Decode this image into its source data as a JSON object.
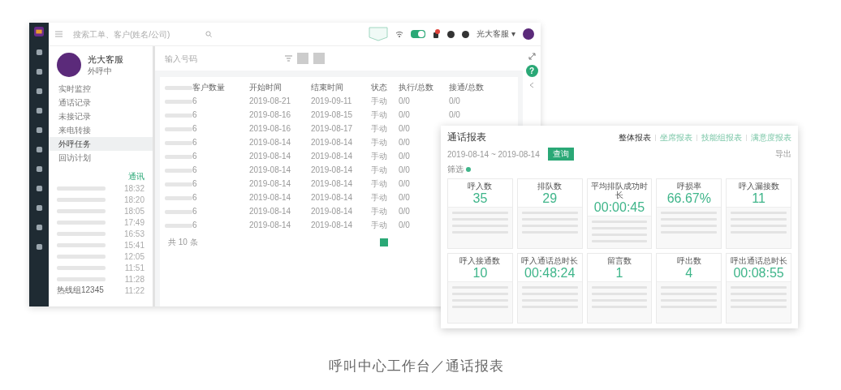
{
  "topbar": {
    "search": {
      "placeholder": "搜索工单、客户(姓名/公司)"
    },
    "status_switch": {
      "on": true
    },
    "user": "光大客服 ▾"
  },
  "profile": {
    "name": "光大客服",
    "status": "外呼中"
  },
  "menu": [
    {
      "label": "实时监控",
      "selected": false
    },
    {
      "label": "通话记录",
      "selected": false
    },
    {
      "label": "未接记录",
      "selected": false
    },
    {
      "label": "来电转接",
      "selected": false
    },
    {
      "label": "外呼任务",
      "selected": true
    },
    {
      "label": "回访计划",
      "selected": false
    }
  ],
  "contacts": {
    "header": "通讯",
    "items": [
      {
        "time": "18:32"
      },
      {
        "time": "18:20"
      },
      {
        "time": "18:05"
      },
      {
        "time": "17:49"
      },
      {
        "time": "16:53"
      },
      {
        "time": "15:41"
      },
      {
        "time": "12:05"
      },
      {
        "time": "11:51"
      },
      {
        "time": "11:28"
      },
      {
        "name": "热线组12345",
        "time": "11:22"
      }
    ]
  },
  "toolbar": {
    "search": {
      "placeholder": "输入号码"
    }
  },
  "table": {
    "columns": [
      "客户数量",
      "开始时间",
      "结束时间",
      "状态",
      "执行/总数",
      "接通/总数"
    ],
    "rows": [
      {
        "count": "6",
        "start": "2019-08-21",
        "end": "2019-09-11",
        "status": "手动",
        "executed": "0/0",
        "connected": "0/0"
      },
      {
        "count": "6",
        "start": "2019-08-16",
        "end": "2019-08-15",
        "status": "手动",
        "executed": "0/0",
        "connected": "0/0"
      },
      {
        "count": "6",
        "start": "2019-08-16",
        "end": "2019-08-17",
        "status": "手动",
        "executed": "0/0"
      },
      {
        "count": "6",
        "start": "2019-08-14",
        "end": "2019-08-14",
        "status": "手动",
        "executed": "0/0"
      },
      {
        "count": "6",
        "start": "2019-08-14",
        "end": "2019-08-14",
        "status": "手动",
        "executed": "0/0"
      },
      {
        "count": "6",
        "start": "2019-08-14",
        "end": "2019-08-14",
        "status": "手动",
        "executed": "0/0"
      },
      {
        "count": "6",
        "start": "2019-08-14",
        "end": "2019-08-14",
        "status": "手动",
        "executed": "0/0"
      },
      {
        "count": "6",
        "start": "2019-08-14",
        "end": "2019-08-14",
        "status": "手动",
        "executed": "0/0"
      },
      {
        "count": "6",
        "start": "2019-08-14",
        "end": "2019-08-14",
        "status": "手动",
        "executed": "0/0"
      },
      {
        "count": "6",
        "start": "2019-08-14",
        "end": "2019-08-14",
        "status": "手动",
        "executed": "0/0"
      }
    ],
    "total": "共 10 条"
  },
  "help": "?",
  "report": {
    "title": "通话报表",
    "tabs": [
      {
        "label": "整体报表",
        "selected": true
      },
      {
        "label": "坐席报表",
        "selected": false
      },
      {
        "label": "技能组报表",
        "selected": false
      },
      {
        "label": "满意度报表",
        "selected": false
      }
    ],
    "date_range": "2019-08-14 ~ 2019-08-14",
    "query_button": "查询",
    "export": "导出",
    "filter_label": "筛选",
    "cards": [
      {
        "title": "呼入数",
        "value": "35"
      },
      {
        "title": "排队数",
        "value": "29"
      },
      {
        "title": "平均排队成功时长",
        "value": "00:00:45"
      },
      {
        "title": "呼损率",
        "value": "66.67%"
      },
      {
        "title": "呼入漏接数",
        "value": "11"
      },
      {
        "title": "呼入接通数",
        "value": "10"
      },
      {
        "title": "呼入通话总时长",
        "value": "00:48:24"
      },
      {
        "title": "留言数",
        "value": "1"
      },
      {
        "title": "呼出数",
        "value": "4"
      },
      {
        "title": "呼出通话总时长",
        "value": "00:08:55"
      }
    ]
  },
  "caption": "呼叫中心工作台／通话报表"
}
